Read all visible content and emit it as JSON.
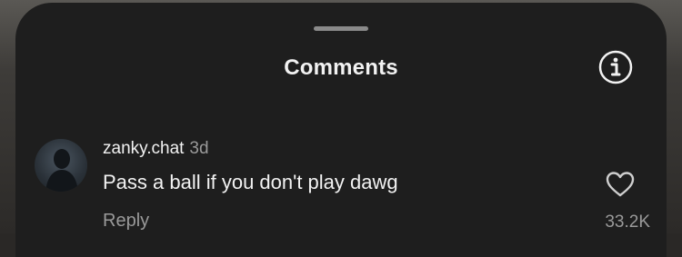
{
  "sheet": {
    "title": "Comments",
    "info_icon": "info-circle-icon"
  },
  "comment": {
    "username": "zanky.chat",
    "time": "3d",
    "text": "Pass a ball if you don't play dawg",
    "reply_label": "Reply",
    "like_count": "33.2K",
    "like_icon": "heart-outline-icon"
  },
  "colors": {
    "sheet_bg": "#1e1e1e",
    "primary_text": "#f2f2f2",
    "secondary_text": "#9a9a9a"
  }
}
